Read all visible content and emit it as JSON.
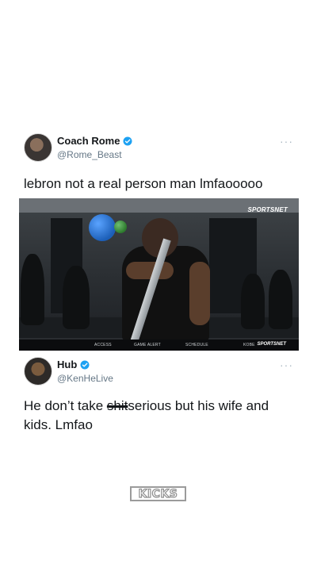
{
  "tweets": [
    {
      "display_name": "Coach Rome",
      "handle": "@Rome_Beast",
      "verified": true,
      "text": "lebron not a real person man lmfaooooo",
      "more_label": "···",
      "media": {
        "logo": "SPORTSNET",
        "menu": [
          "ACCESS",
          "GAME ALERT",
          "SCHEDULE",
          "KOBE",
          "SPORTSNET"
        ]
      }
    },
    {
      "display_name": "Hub",
      "handle": "@KenHeLive",
      "verified": true,
      "text_before": "He don’t take ",
      "text_struck": "shit",
      "text_after": "serious but his wife and kids. Lmfao",
      "more_label": "···"
    }
  ],
  "watermark": "KICKS",
  "colors": {
    "verified": "#1da1f2",
    "text": "#14171a",
    "handle": "#657786"
  }
}
